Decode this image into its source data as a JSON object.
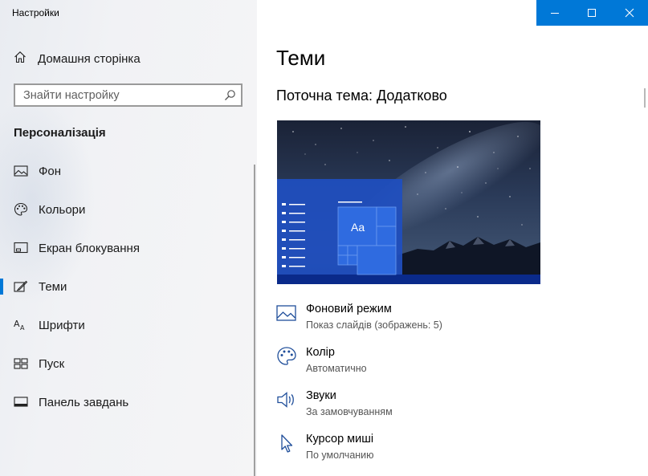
{
  "window": {
    "title": "Настройки",
    "controls": [
      "minimize-icon",
      "maximize-icon",
      "close-icon"
    ],
    "accent": "#0078d7"
  },
  "sidebar": {
    "home_label": "Домашня сторінка",
    "search_placeholder": "Знайти настройку",
    "section_title": "Персоналізація",
    "items": [
      {
        "label": "Фон",
        "icon": "picture-icon",
        "active": false
      },
      {
        "label": "Кольори",
        "icon": "palette-icon",
        "active": false
      },
      {
        "label": "Екран блокування",
        "icon": "lock-screen-icon",
        "active": false
      },
      {
        "label": "Теми",
        "icon": "themes-brush-icon",
        "active": true
      },
      {
        "label": "Шрифти",
        "icon": "fonts-icon",
        "active": false
      },
      {
        "label": "Пуск",
        "icon": "start-icon",
        "active": false
      },
      {
        "label": "Панель завдань",
        "icon": "taskbar-icon",
        "active": false
      }
    ]
  },
  "main": {
    "title": "Теми",
    "current_theme": "Поточна тема: Додатково",
    "preview": {
      "tile_text": "Aa"
    },
    "options": [
      {
        "title": "Фоновий режим",
        "subtitle": "Показ слайдів (зображень: 5)",
        "icon": "picture-icon"
      },
      {
        "title": "Колір",
        "subtitle": "Автоматично",
        "icon": "palette-icon"
      },
      {
        "title": "Звуки",
        "subtitle": "За замовчуванням",
        "icon": "speaker-icon"
      },
      {
        "title": "Курсор миші",
        "subtitle": "По умолчанию",
        "icon": "cursor-icon"
      }
    ]
  }
}
